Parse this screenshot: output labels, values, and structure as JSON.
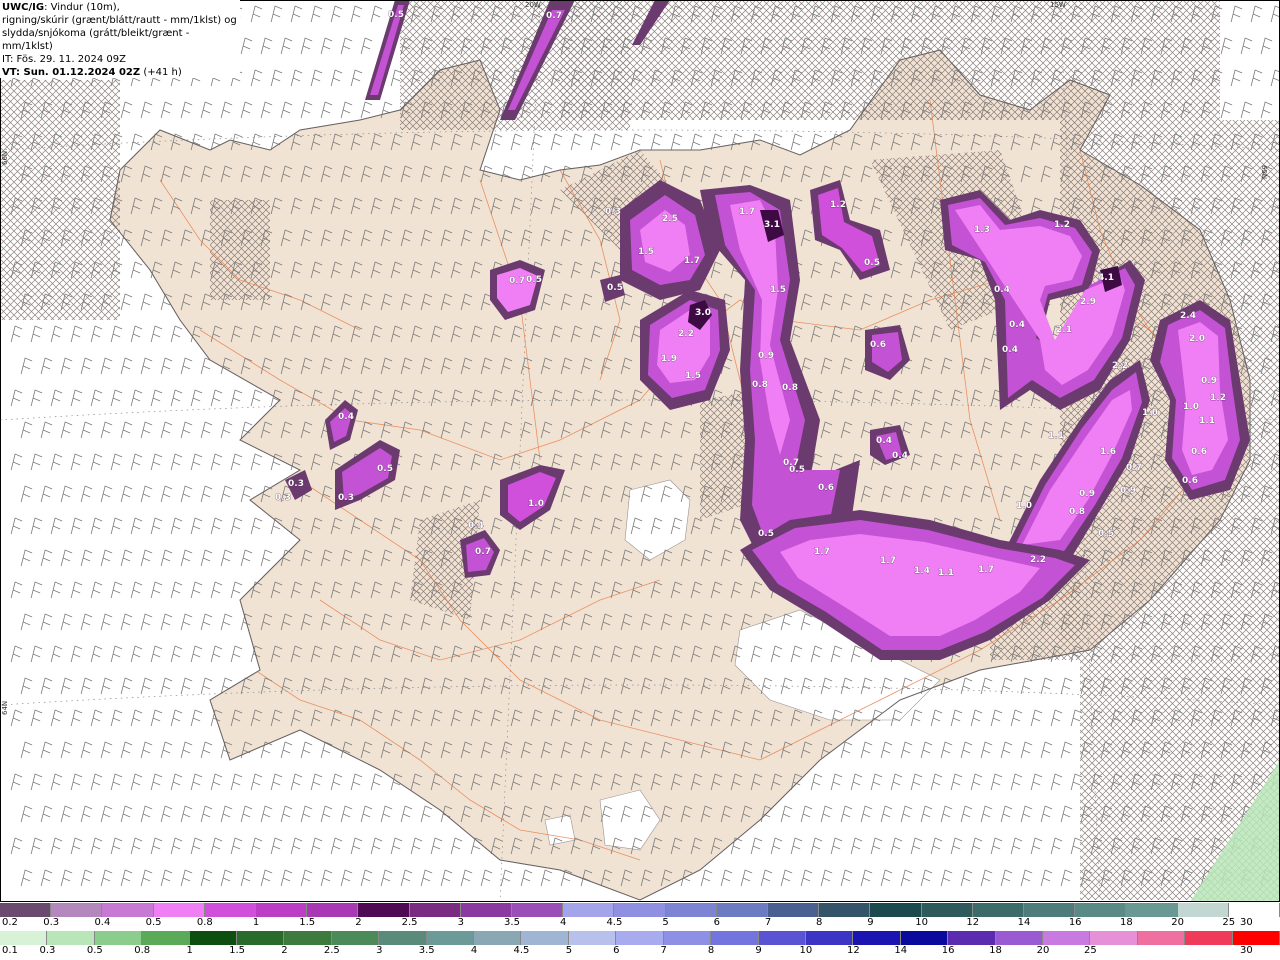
{
  "header": {
    "model": "UWC/IG",
    "line1_rest": ": Vindur (10m),",
    "line2": "rigning/skúrir (grænt/blátt/rautt - mm/1klst) og",
    "line3": "slydda/snjókoma (grátt/bleikt/grænt - mm/1klst)",
    "it": "IT: Fös. 29. 11. 2024 09Z",
    "vt": "VT: Sun. 01.12.2024 02Z",
    "vt_offset": "(+41 h)"
  },
  "grid_labels": {
    "lon_20w": "20W",
    "lon_15w": "15W",
    "lat_66n": "66N",
    "lat_65n": "65N",
    "lat_64n": "64N"
  },
  "precip_values": [
    {
      "id": "v1",
      "text": "0.5"
    },
    {
      "id": "v2",
      "text": "0.7"
    },
    {
      "id": "v3",
      "text": "0.3"
    },
    {
      "id": "v4",
      "text": "2.5"
    },
    {
      "id": "v5",
      "text": "1.5"
    },
    {
      "id": "v6",
      "text": "1.7"
    },
    {
      "id": "v7",
      "text": "0.5"
    },
    {
      "id": "v8",
      "text": "3.0"
    },
    {
      "id": "v9",
      "text": "2.2"
    },
    {
      "id": "v10",
      "text": "1.9"
    },
    {
      "id": "v11",
      "text": "1.5"
    },
    {
      "id": "v12",
      "text": "1.7"
    },
    {
      "id": "v13",
      "text": "3.1"
    },
    {
      "id": "v14",
      "text": "1.5"
    },
    {
      "id": "v15",
      "text": "0.9"
    },
    {
      "id": "v16",
      "text": "0.8"
    },
    {
      "id": "v17",
      "text": "1.2"
    },
    {
      "id": "v18",
      "text": "0.5"
    },
    {
      "id": "v19",
      "text": "1.3"
    },
    {
      "id": "v20",
      "text": "1.2"
    },
    {
      "id": "v21",
      "text": "0.4"
    },
    {
      "id": "v22",
      "text": "4.1"
    },
    {
      "id": "v23",
      "text": "2.9"
    },
    {
      "id": "v24",
      "text": "2.1"
    },
    {
      "id": "v25",
      "text": "0.4"
    },
    {
      "id": "v26",
      "text": "0.4"
    },
    {
      "id": "v27",
      "text": "0.6"
    },
    {
      "id": "v28",
      "text": "2.4"
    },
    {
      "id": "v29",
      "text": "2.0"
    },
    {
      "id": "v30",
      "text": "2.2"
    },
    {
      "id": "v31",
      "text": "0.9"
    },
    {
      "id": "v32",
      "text": "1.2"
    },
    {
      "id": "v33",
      "text": "1.0"
    },
    {
      "id": "v34",
      "text": "1.0"
    },
    {
      "id": "v35",
      "text": "1.1"
    },
    {
      "id": "v36",
      "text": "1.1"
    },
    {
      "id": "v37",
      "text": "0.6"
    },
    {
      "id": "v38",
      "text": "1.6"
    },
    {
      "id": "v39",
      "text": "0.7"
    },
    {
      "id": "v40",
      "text": "0.6"
    },
    {
      "id": "v41",
      "text": "0.9"
    },
    {
      "id": "v42",
      "text": "0.8"
    },
    {
      "id": "v43",
      "text": "0.9"
    },
    {
      "id": "v44",
      "text": "1.0"
    },
    {
      "id": "v45",
      "text": "0.8"
    },
    {
      "id": "v46",
      "text": "0.5"
    },
    {
      "id": "v47",
      "text": "0.4"
    },
    {
      "id": "v48",
      "text": "0.4"
    },
    {
      "id": "v49",
      "text": "0.5"
    },
    {
      "id": "v50",
      "text": "0.6"
    },
    {
      "id": "v51",
      "text": "0.5"
    },
    {
      "id": "v52",
      "text": "1.7"
    },
    {
      "id": "v53",
      "text": "1.7"
    },
    {
      "id": "v54",
      "text": "1.4"
    },
    {
      "id": "v55",
      "text": "1.1"
    },
    {
      "id": "v56",
      "text": "1.7"
    },
    {
      "id": "v57",
      "text": "2.2"
    },
    {
      "id": "v58",
      "text": "0.4"
    },
    {
      "id": "v59",
      "text": "0.5"
    },
    {
      "id": "v60",
      "text": "0.3"
    },
    {
      "id": "v61",
      "text": "0.3"
    },
    {
      "id": "v62",
      "text": "1.0"
    },
    {
      "id": "v63",
      "text": "0.4"
    },
    {
      "id": "v64",
      "text": "0.7"
    },
    {
      "id": "v65",
      "text": "0.7"
    },
    {
      "id": "v66",
      "text": "0.5"
    },
    {
      "id": "v67",
      "text": "0.7"
    },
    {
      "id": "v68",
      "text": "0.3"
    }
  ],
  "legend_snow": {
    "colors": [
      "#6a4a6e",
      "#b588bd",
      "#c67ad4",
      "#f07ef4",
      "#d050dc",
      "#bb3ec4",
      "#a838b4",
      "#4e0a52",
      "#7a2c82",
      "#8a3aa0",
      "#9a4eb8",
      "#a4a4ea",
      "#9090e2",
      "#7e84d4",
      "#6c7cc2",
      "#4a6090",
      "#34546a",
      "#1a4a4e",
      "#2e5a5c",
      "#3c6c6a",
      "#4e7c7a",
      "#5a8a86",
      "#6a9892",
      "#c2d6d2",
      "#ffffff"
    ],
    "labels": [
      "0.2",
      "0.3",
      "0.4",
      "0.5",
      "0.8",
      "1",
      "1.5",
      "2",
      "2.5",
      "3",
      "3.5",
      "4",
      "4.5",
      "5",
      "6",
      "7",
      "8",
      "9",
      "10",
      "12",
      "14",
      "16",
      "18",
      "20",
      "25",
      "30"
    ]
  },
  "legend_rain": {
    "colors": [
      "#d8f2d8",
      "#b8e6b8",
      "#8ccc8c",
      "#5aaa5a",
      "#0e4e0e",
      "#2a6a2a",
      "#3e7a3e",
      "#4c8a5a",
      "#5a8a7a",
      "#6c9a98",
      "#8aa8b4",
      "#a0b4d4",
      "#b8c0ec",
      "#a8acee",
      "#8e90e6",
      "#7474de",
      "#5a54d4",
      "#3c34c4",
      "#1c14b0",
      "#0a0a9c",
      "#5c2cb0",
      "#9a5ad4",
      "#c87ae0",
      "#e690d8",
      "#ef6fa0",
      "#f03a5a",
      "#ff0000"
    ],
    "labels": [
      "0.1",
      "0.3",
      "0.5",
      "0.8",
      "1",
      "1.5",
      "2",
      "2.5",
      "3",
      "3.5",
      "4",
      "4.5",
      "5",
      "6",
      "7",
      "8",
      "9",
      "10",
      "12",
      "14",
      "16",
      "18",
      "20",
      "25",
      "30"
    ]
  },
  "colors": {
    "land": "#f1e3d4",
    "sea": "#ffffff",
    "road": "#e8824e",
    "barb": "#7a7a7a",
    "precip_light": "#6b3a6e",
    "precip_mid": "#c352d4",
    "precip_high": "#f07ef4",
    "precip_peak": "#3e0a44"
  }
}
